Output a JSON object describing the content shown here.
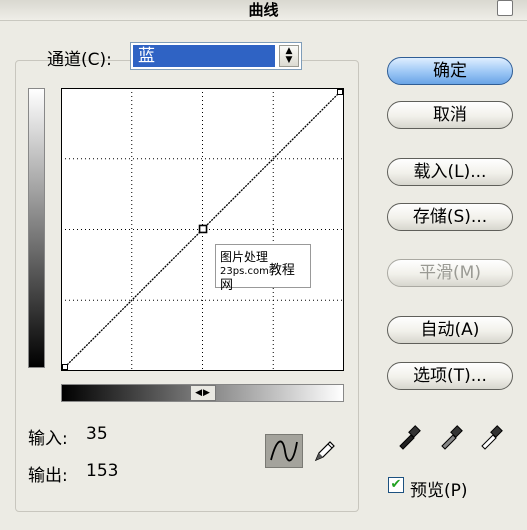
{
  "window": {
    "title": "曲线"
  },
  "channel": {
    "label": "通道(C):",
    "value": "蓝"
  },
  "buttons": {
    "ok": "确定",
    "cancel": "取消",
    "load": "载入(L)...",
    "save": "存储(S)...",
    "smooth": "平滑(M)",
    "auto": "自动(A)",
    "options": "选项(T)..."
  },
  "io": {
    "input_label": "输入:",
    "input_value": "35",
    "output_label": "输出:",
    "output_value": "153"
  },
  "preview": {
    "label": "预览(P)",
    "checked": true
  },
  "watermark": {
    "line1": "图片处理",
    "line2_small": "23ps.com",
    "line2_big": "教程网"
  },
  "curve": {
    "grid_divisions": 4,
    "points": [
      [
        0,
        0
      ],
      [
        128,
        128
      ],
      [
        255,
        255
      ]
    ]
  },
  "colors": {
    "primary_button": "#9bc6f5",
    "channel_highlight": "#2f63c4",
    "check": "#21a121"
  },
  "icons": {
    "curve_tool": "curve-tool-icon",
    "pencil_tool": "pencil-icon",
    "droppers": [
      "black-eyedropper-icon",
      "gray-eyedropper-icon",
      "white-eyedropper-icon"
    ]
  }
}
